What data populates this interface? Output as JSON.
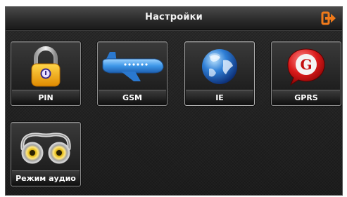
{
  "header": {
    "title": "Настройки",
    "exit_icon": "exit-icon"
  },
  "tiles": [
    {
      "label": "PIN",
      "icon": "padlock-icon"
    },
    {
      "label": "GSM",
      "icon": "airplane-icon"
    },
    {
      "label": "IE",
      "icon": "globe-icon"
    },
    {
      "label": "GPRS",
      "icon": "g-badge-icon"
    },
    {
      "label": "Режим аудио",
      "icon": "speakers-icon"
    }
  ],
  "colors": {
    "accent": "#f07a1a",
    "tile_label_text": "#ffffff",
    "background": "#222222"
  }
}
